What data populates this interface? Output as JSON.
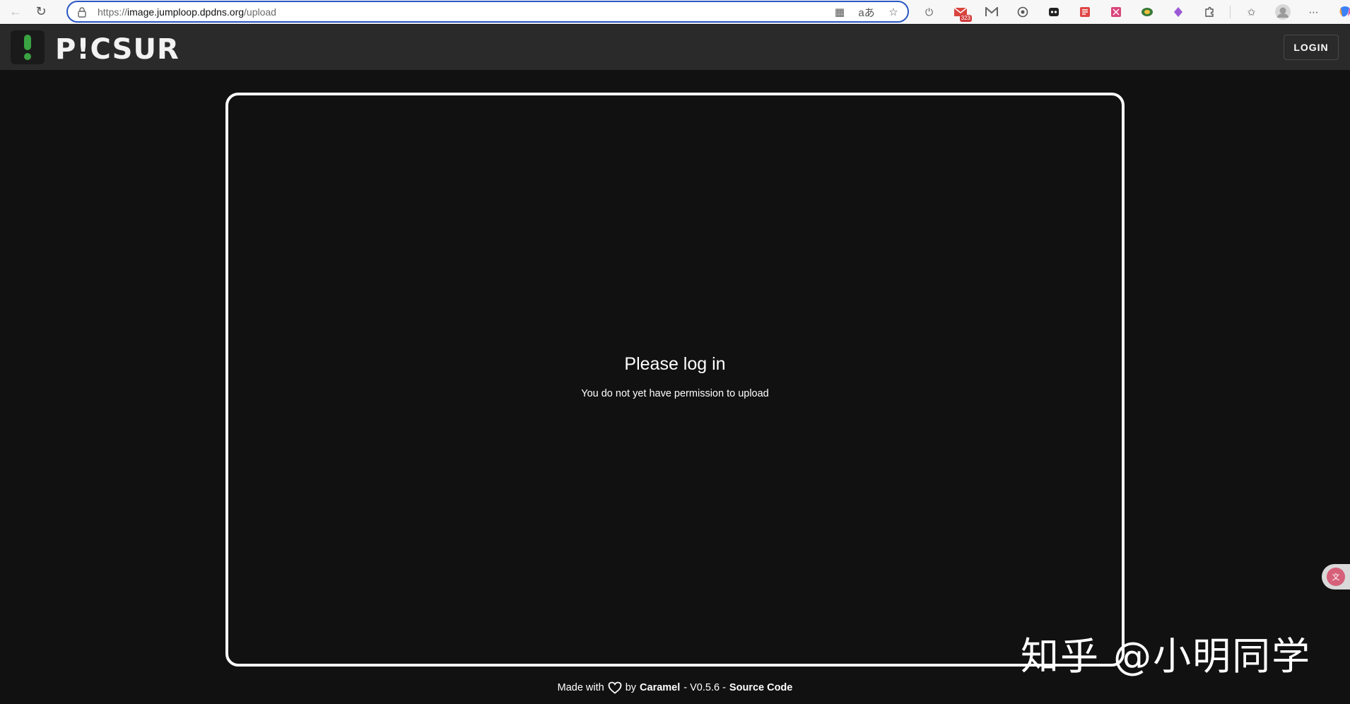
{
  "browser": {
    "url_scheme": "https://",
    "url_host": "image.jumploop.dpdns.org",
    "url_path": "/upload",
    "mail_badge": "323"
  },
  "header": {
    "logo_text": "P!CSUR",
    "login_label": "LOGIN"
  },
  "panel": {
    "title": "Please log in",
    "subtitle": "You do not yet have permission to upload"
  },
  "footer": {
    "made_with": "Made with",
    "by": "by",
    "author": "Caramel",
    "version": "- V0.5.6 -",
    "source_code": "Source Code"
  },
  "watermark": {
    "text": "知乎 @小明同学"
  },
  "colors": {
    "accent_green": "#3aa342",
    "address_border": "#2b58c4",
    "page_bg": "#111111",
    "header_bg": "#2a2a2a"
  }
}
